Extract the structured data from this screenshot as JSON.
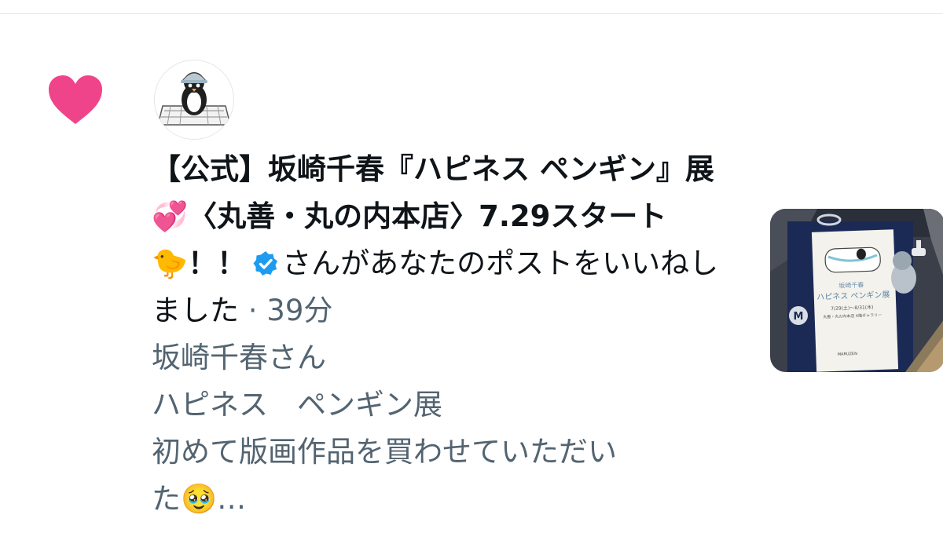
{
  "notification": {
    "account_name": "【公式】坂崎千春『ハピネス ペンギン』展💞〈丸善・丸の内本店〉7.29スタート🐤！！",
    "action_text": "さんがあなたのポストをいいねしました",
    "separator": "·",
    "timestamp": "39分",
    "preview_lines": [
      "坂崎千春さん",
      "ハピネス　ペンギン展",
      "初めて版画作品を買わせていただい",
      "た🥹…"
    ],
    "icons": {
      "like": "heart-icon",
      "verified": "verified-badge-icon",
      "avatar": "penguin-avatar",
      "thumbnail": "photo-thumbnail"
    },
    "colors": {
      "like": "#f0448a",
      "verified": "#1d9bf0",
      "muted": "#536471",
      "text": "#0f1419"
    },
    "thumbnail_text": {
      "title_small": "坂崎千春",
      "title": "ハピネス ペンギン展",
      "dates": "7/29(土)〜8/31(木)",
      "store": "丸善・丸の内本店 4階ギャラリー",
      "logo_letter": "M",
      "brand": "MARUZEN"
    }
  }
}
